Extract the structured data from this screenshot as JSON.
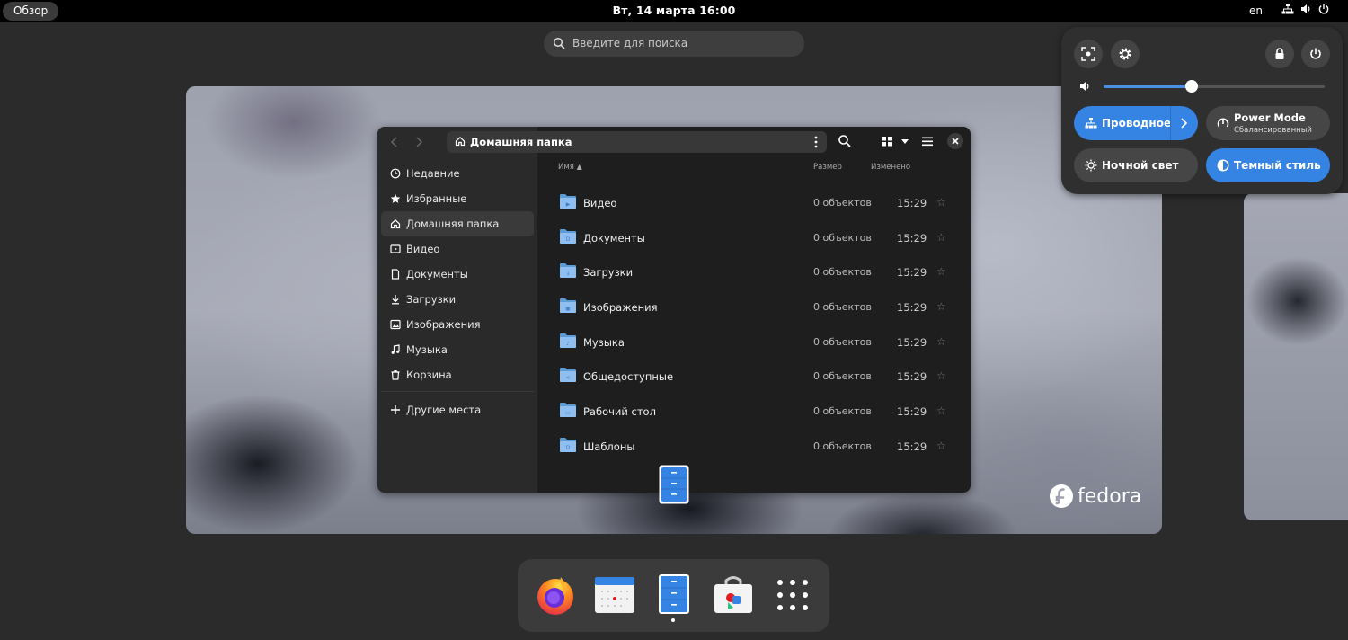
{
  "topbar": {
    "overview_label": "Обзор",
    "clock": "Вт, 14 марта  16:00",
    "keyboard_layout": "en",
    "status_icons": [
      "network-wired-icon",
      "volume-icon",
      "power-icon"
    ]
  },
  "search": {
    "placeholder": "Введите для поиска"
  },
  "wallpaper": {
    "brand": "fedora"
  },
  "file_manager": {
    "path_label": "Домашняя папка",
    "sidebar": {
      "items": [
        {
          "label": "Недавние",
          "icon": "clock-icon"
        },
        {
          "label": "Избранные",
          "icon": "star-icon"
        },
        {
          "label": "Домашняя папка",
          "icon": "home-icon",
          "active": true
        },
        {
          "label": "Видео",
          "icon": "video-icon"
        },
        {
          "label": "Документы",
          "icon": "document-icon"
        },
        {
          "label": "Загрузки",
          "icon": "download-icon"
        },
        {
          "label": "Изображения",
          "icon": "image-icon"
        },
        {
          "label": "Музыка",
          "icon": "music-icon"
        },
        {
          "label": "Корзина",
          "icon": "trash-icon"
        }
      ],
      "other_places": "Другие места"
    },
    "columns": {
      "name": "Имя",
      "size": "Размер",
      "modified": "Изменено"
    },
    "rows": [
      {
        "name": "Видео",
        "size": "0 объектов",
        "time": "15:29",
        "glyph": "▶"
      },
      {
        "name": "Документы",
        "size": "0 объектов",
        "time": "15:29",
        "glyph": "D"
      },
      {
        "name": "Загрузки",
        "size": "0 объектов",
        "time": "15:29",
        "glyph": "↓"
      },
      {
        "name": "Изображения",
        "size": "0 объектов",
        "time": "15:29",
        "glyph": "▣"
      },
      {
        "name": "Музыка",
        "size": "0 объектов",
        "time": "15:29",
        "glyph": "♪"
      },
      {
        "name": "Общедоступные",
        "size": "0 объектов",
        "time": "15:29",
        "glyph": "<"
      },
      {
        "name": "Рабочий стол",
        "size": "0 объектов",
        "time": "15:29",
        "glyph": "▭"
      },
      {
        "name": "Шаблоны",
        "size": "0 объектов",
        "time": "15:29",
        "glyph": "D"
      }
    ]
  },
  "dock": {
    "apps": [
      "firefox-icon",
      "calendar-icon",
      "files-icon",
      "software-icon",
      "app-grid-icon"
    ],
    "running": "files-icon"
  },
  "quick_settings": {
    "volume_percent": 40,
    "wired_label": "Проводное",
    "power_mode_title": "Power Mode",
    "power_mode_subtitle": "Сбалансированный",
    "night_light_label": "Ночной свет",
    "dark_style_label": "Темный стиль",
    "colors": {
      "accent": "#3584e4",
      "panel": "#2f2f2f"
    }
  }
}
